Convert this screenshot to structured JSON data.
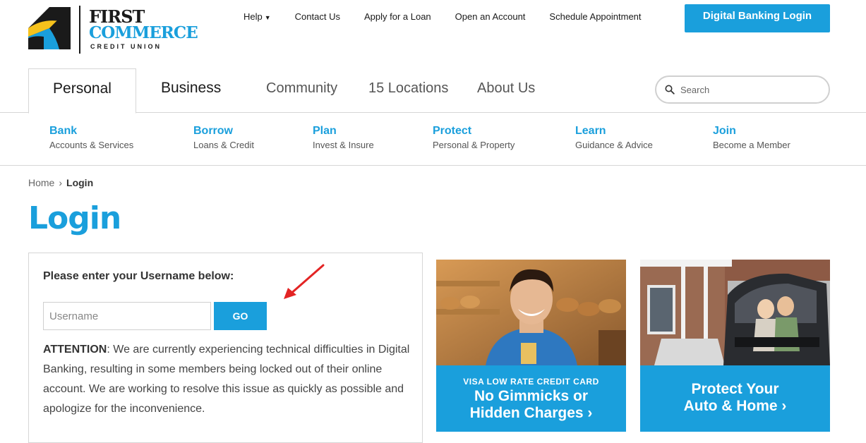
{
  "brand": {
    "name_line1": "First",
    "name_line2": "Commerce",
    "name_line3": "CREDIT UNION",
    "colors": {
      "accent": "#1a9fdc",
      "yellow": "#f6c21c",
      "dark": "#1a1a1a"
    }
  },
  "utility_nav": {
    "items": [
      {
        "label": "Help",
        "has_dropdown": true
      },
      {
        "label": "Contact Us"
      },
      {
        "label": "Apply for a Loan"
      },
      {
        "label": "Open an Account"
      },
      {
        "label": "Schedule Appointment"
      }
    ],
    "login_button": "Digital Banking Login"
  },
  "main_nav": {
    "tabs": [
      {
        "label": "Personal",
        "active": true
      },
      {
        "label": "Business"
      },
      {
        "label": "Community"
      },
      {
        "label": "15 Locations"
      },
      {
        "label": "About Us"
      }
    ],
    "search": {
      "placeholder": "Search",
      "icon": "search-icon"
    }
  },
  "sub_nav": {
    "items": [
      {
        "title": "Bank",
        "subtitle": "Accounts & Services"
      },
      {
        "title": "Borrow",
        "subtitle": "Loans & Credit"
      },
      {
        "title": "Plan",
        "subtitle": "Invest & Insure"
      },
      {
        "title": "Protect",
        "subtitle": "Personal & Property"
      },
      {
        "title": "Learn",
        "subtitle": "Guidance & Advice"
      },
      {
        "title": "Join",
        "subtitle": "Become a Member"
      }
    ]
  },
  "breadcrumb": {
    "home": "Home",
    "separator": "›",
    "current": "Login"
  },
  "page": {
    "title": "Login"
  },
  "login_form": {
    "label": "Please enter your Username below:",
    "username_placeholder": "Username",
    "username_value": "",
    "submit_label": "GO",
    "notice_heading": "ATTENTION",
    "notice_body": ": We are currently experiencing technical difficulties in Digital Banking, resulting in some members being locked out of their online account. We are working to resolve this issue as quickly as possible and apologize for the inconvenience."
  },
  "promos": [
    {
      "kicker": "VISA LOW RATE CREDIT CARD",
      "headline_line1": "No Gimmicks or",
      "headline_line2": "Hidden Charges ›"
    },
    {
      "kicker": "",
      "headline_line1": "Protect Your",
      "headline_line2": "Auto & Home ›"
    }
  ]
}
